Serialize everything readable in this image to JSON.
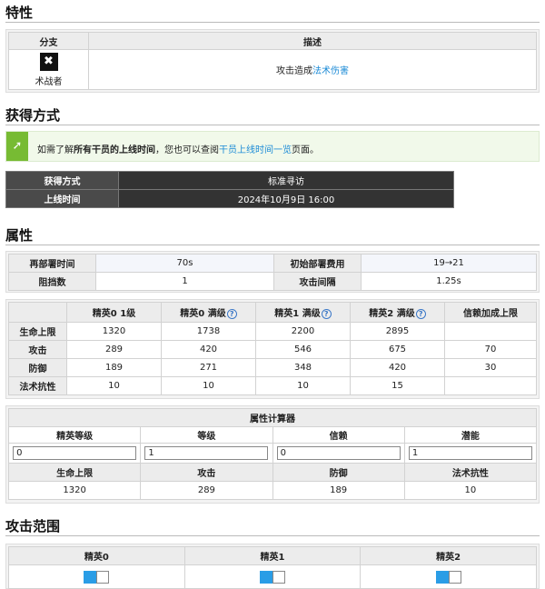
{
  "traits": {
    "heading": "特性",
    "col_branch": "分支",
    "col_desc": "描述",
    "branch_name": "术战者",
    "desc_prefix": "攻击造成",
    "desc_link": "法术伤害"
  },
  "acquire": {
    "heading": "获得方式",
    "info_pre": "如需了解",
    "info_bold": "所有干员的上线时间",
    "info_mid": "，您也可以查阅",
    "info_link": "干员上线时间一览",
    "info_post": "页面。",
    "method_label": "获得方式",
    "method_value": "标准寻访",
    "date_label": "上线时间",
    "date_value": "2024年10月9日 16:00"
  },
  "attrs": {
    "heading": "属性",
    "redeploy_label": "再部署时间",
    "redeploy_value": "70s",
    "cost_label": "初始部署费用",
    "cost_value": "19→21",
    "block_label": "阻挡数",
    "block_value": "1",
    "interval_label": "攻击间隔",
    "interval_value": "1.25s",
    "columns": [
      "精英0 1级",
      "精英0 满级",
      "精英1 满级",
      "精英2 满级",
      "信赖加成上限"
    ],
    "rows": [
      {
        "label": "生命上限",
        "values": [
          "1320",
          "1738",
          "2200",
          "2895"
        ],
        "trust": ""
      },
      {
        "label": "攻击",
        "values": [
          "289",
          "420",
          "546",
          "675"
        ],
        "trust": "70"
      },
      {
        "label": "防御",
        "values": [
          "189",
          "271",
          "348",
          "420"
        ],
        "trust": "30"
      },
      {
        "label": "法术抗性",
        "values": [
          "10",
          "10",
          "10",
          "15"
        ],
        "trust": ""
      }
    ]
  },
  "calc": {
    "title": "属性计算器",
    "input_labels": [
      "精英等级",
      "等级",
      "信赖",
      "潜能"
    ],
    "input_values": [
      "0",
      "1",
      "0",
      "1"
    ],
    "out_labels": [
      "生命上限",
      "攻击",
      "防御",
      "法术抗性"
    ],
    "out_values": [
      "1320",
      "289",
      "189",
      "10"
    ]
  },
  "range": {
    "heading": "攻击范围",
    "cols": [
      "精英0",
      "精英1",
      "精英2"
    ]
  },
  "colors": {
    "accent": "#2a9de6",
    "link": "#1a8ad6",
    "info_icon": "#77bb33"
  }
}
